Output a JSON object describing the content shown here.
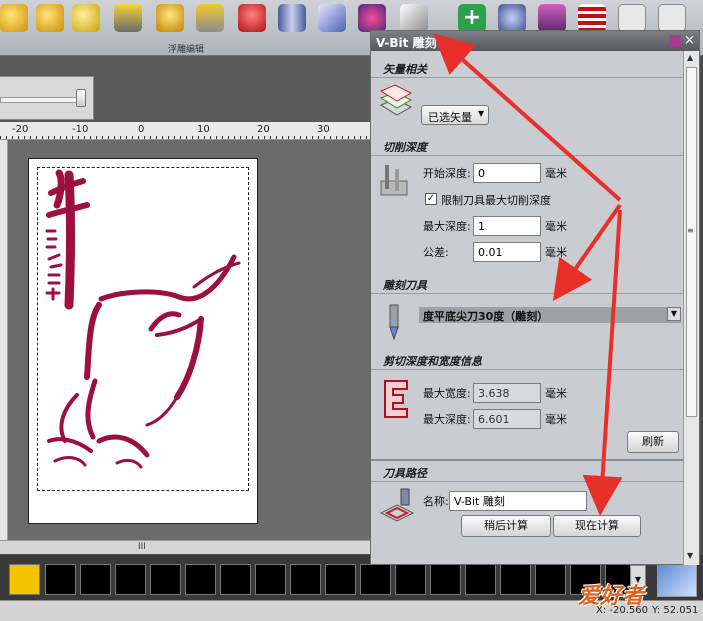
{
  "toolbar": {
    "caption": "浮雕编辑",
    "icons": [
      "relief-tool-icon",
      "relief-tool-icon",
      "relief-tool-icon",
      "relief-tool-icon",
      "relief-tool-icon",
      "relief-tool-icon",
      "relief-tool-icon",
      "relief-tool-icon",
      "relief-tool-icon",
      "relief-tool-icon",
      "relief-tool-icon",
      "add-cross-icon",
      "vase-icon",
      "relief-tool-icon",
      "relief-tool-icon",
      "relief-tool-icon",
      "relief-tool-icon"
    ]
  },
  "ruler": {
    "labels": [
      "-20",
      "-10",
      "0",
      "10",
      "20",
      "30"
    ]
  },
  "panel": {
    "title": "V-Bit 雕刻",
    "vector": {
      "heading": "矢量相关",
      "dropdown_label": "已选矢量"
    },
    "depth": {
      "heading": "切削深度",
      "start_label": "开始深度:",
      "start_value": "0",
      "limit_label": "限制刀具最大切削深度",
      "limit_checked": "✓",
      "max_label": "最大深度:",
      "max_value": "1",
      "tol_label": "公差:",
      "tol_value": "0.01",
      "unit": "毫米"
    },
    "tool": {
      "heading": "雕刻刀具",
      "name": "度平底尖刀30度（雕刻）"
    },
    "info": {
      "heading": "剪切深度和宽度信息",
      "width_label": "最大宽度:",
      "width_value": "3.638",
      "depth_label": "最大深度:",
      "depth_value": "6.601",
      "unit": "毫米",
      "refresh": "刷新"
    },
    "toolpath": {
      "heading": "刀具路径",
      "name_label": "名称:",
      "name_value": "V-Bit 雕刻",
      "later": "稍后计算",
      "now": "现在计算"
    }
  },
  "palette": {
    "selected_color": "#f5c400",
    "swatch_color": "#000000"
  },
  "status": {
    "x": "X: -20.560",
    "y": "Y: 52.051"
  },
  "watermark": "爱好者",
  "colors": {
    "artwork": "#9c0f3f",
    "arrow": "#e8302a"
  }
}
